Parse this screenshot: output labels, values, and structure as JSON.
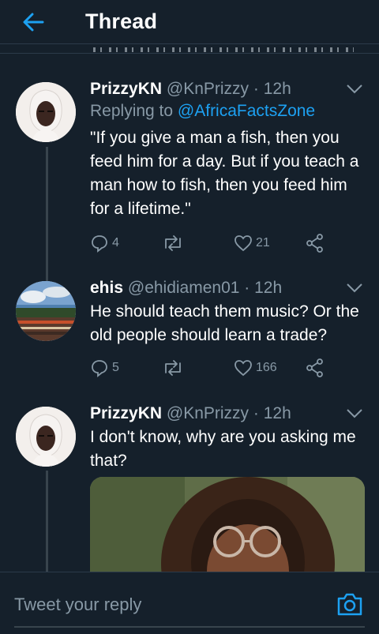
{
  "header": {
    "title": "Thread",
    "back_icon": "arrow-left-icon",
    "accent": "#1da1f2"
  },
  "tweets": [
    {
      "name": "PrizzyKN",
      "handle": "@KnPrizzy",
      "time": "· 12h",
      "replying_label": "Replying to",
      "replying_to": "@AfricaFactsZone",
      "text": "\"If you give a man a fish, then you feed him for a day. But if you teach a man how to fish, then you feed him for a lifetime.\"",
      "replies": "4",
      "retweets": "",
      "likes": "21"
    },
    {
      "name": "ehis",
      "handle": "@ehidiamen01",
      "time": "· 12h",
      "text": "He should teach them music? Or the old people should learn a trade?",
      "replies": "5",
      "retweets": "",
      "likes": "166"
    },
    {
      "name": "PrizzyKN",
      "handle": "@KnPrizzy",
      "time": "· 12h",
      "text": "I don't know, why are you asking me that?"
    }
  ],
  "reply_bar": {
    "placeholder": "Tweet your reply",
    "camera_icon": "camera-icon"
  },
  "colors": {
    "background": "#15202b",
    "muted": "#8899a6",
    "link": "#1da1f2",
    "divider": "#38444d"
  }
}
